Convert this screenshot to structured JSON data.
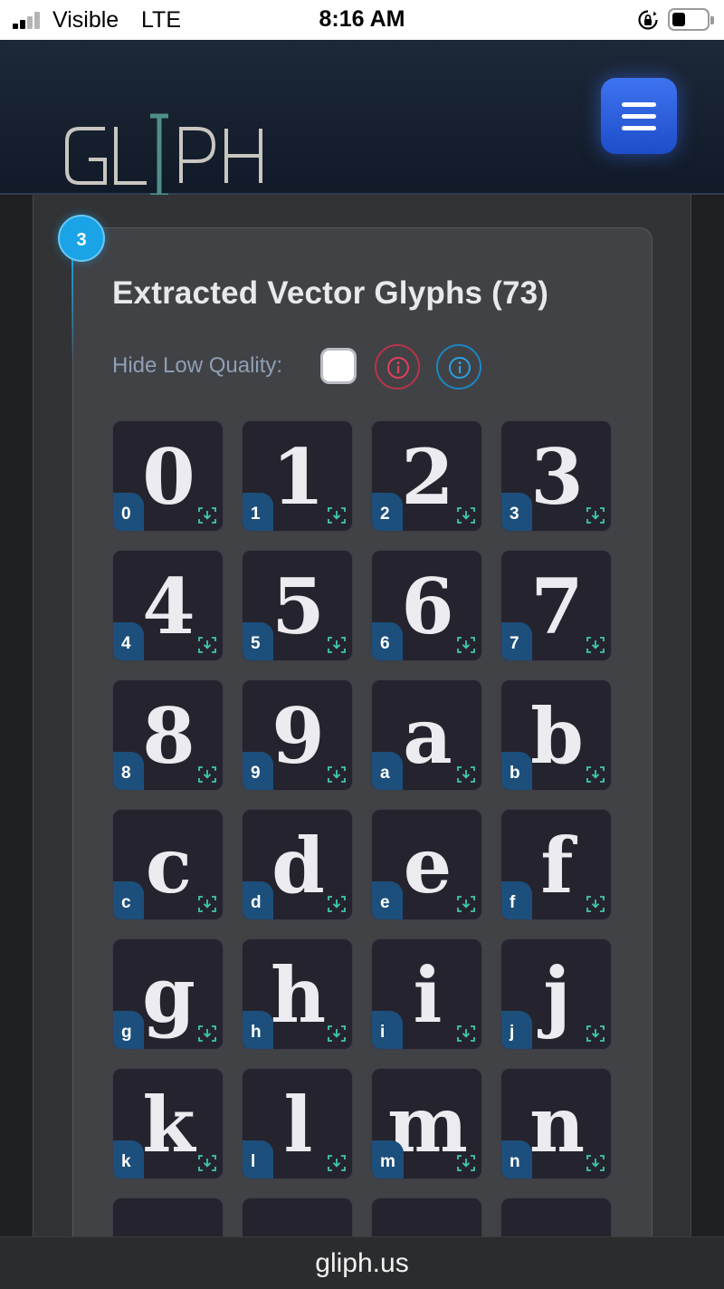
{
  "status_bar": {
    "carrier": "Visible",
    "network": "LTE",
    "time": "8:16 AM"
  },
  "header": {
    "logo_text": "GLIPH",
    "menu_icon": "hamburger-menu-icon",
    "accent_color": "#2f5fe0"
  },
  "section": {
    "step_number": "3",
    "title": "Extracted Vector Glyphs (73)",
    "filter_label": "Hide Low Quality:",
    "hide_low_quality_checked": false,
    "warning_icon": "info-circle-red-icon",
    "info_icon": "info-circle-blue-icon"
  },
  "glyphs": [
    {
      "char": "0",
      "label": "0"
    },
    {
      "char": "1",
      "label": "1"
    },
    {
      "char": "2",
      "label": "2"
    },
    {
      "char": "3",
      "label": "3"
    },
    {
      "char": "4",
      "label": "4"
    },
    {
      "char": "5",
      "label": "5"
    },
    {
      "char": "6",
      "label": "6"
    },
    {
      "char": "7",
      "label": "7"
    },
    {
      "char": "8",
      "label": "8"
    },
    {
      "char": "9",
      "label": "9"
    },
    {
      "char": "a",
      "label": "a"
    },
    {
      "char": "b",
      "label": "b"
    },
    {
      "char": "c",
      "label": "c"
    },
    {
      "char": "d",
      "label": "d"
    },
    {
      "char": "e",
      "label": "e"
    },
    {
      "char": "f",
      "label": "f"
    },
    {
      "char": "g",
      "label": "g"
    },
    {
      "char": "h",
      "label": "h"
    },
    {
      "char": "i",
      "label": "i"
    },
    {
      "char": "j",
      "label": "j"
    },
    {
      "char": "k",
      "label": "k"
    },
    {
      "char": "l",
      "label": "l"
    },
    {
      "char": "m",
      "label": "m"
    },
    {
      "char": "n",
      "label": "n"
    },
    {
      "char": "",
      "label": ""
    },
    {
      "char": "",
      "label": ""
    },
    {
      "char": "",
      "label": ""
    },
    {
      "char": "",
      "label": ""
    }
  ],
  "url_bar": {
    "domain": "gliph.us"
  }
}
